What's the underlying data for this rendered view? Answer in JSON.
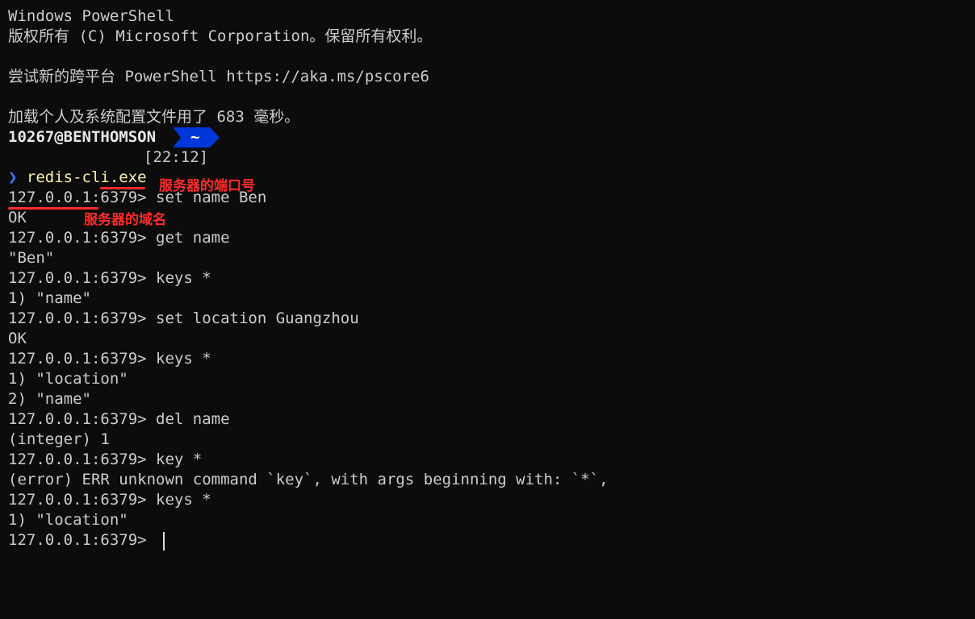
{
  "terminal": {
    "header": {
      "line1": "Windows PowerShell",
      "line2": "版权所有 (C) Microsoft Corporation。保留所有权利。",
      "line3": "尝试新的跨平台 PowerShell https://aka.ms/pscore6",
      "line4": "加载个人及系统配置文件用了 683 毫秒。"
    },
    "prompt": {
      "user_host": "10267@BENTHOMSON",
      "path": "~",
      "time": "[22:12]",
      "chevron": "❯",
      "command": "redis-cli.exe"
    },
    "annotations": {
      "port_label": "服务器的端口号",
      "host_label": "服务器的域名"
    },
    "session": [
      {
        "host": "127.0.0.1",
        "port_part": ":6379> ",
        "cmd": "set name Ben"
      },
      {
        "out": "OK"
      },
      {
        "host": "127.0.0.1",
        "port_part": ":6379> ",
        "cmd": "get name"
      },
      {
        "out": "\"Ben\""
      },
      {
        "host": "127.0.0.1",
        "port_part": ":6379> ",
        "cmd": "keys *"
      },
      {
        "out": "1) \"name\""
      },
      {
        "host": "127.0.0.1",
        "port_part": ":6379> ",
        "cmd": "set location Guangzhou"
      },
      {
        "out": "OK"
      },
      {
        "host": "127.0.0.1",
        "port_part": ":6379> ",
        "cmd": "keys *"
      },
      {
        "out": "1) \"location\""
      },
      {
        "out": "2) \"name\""
      },
      {
        "host": "127.0.0.1",
        "port_part": ":6379> ",
        "cmd": "del name"
      },
      {
        "out": "(integer) 1"
      },
      {
        "host": "127.0.0.1",
        "port_part": ":6379> ",
        "cmd": "key *"
      },
      {
        "out": "(error) ERR unknown command `key`, with args beginning with: `*`,"
      },
      {
        "host": "127.0.0.1",
        "port_part": ":6379> ",
        "cmd": "keys *"
      },
      {
        "out": "1) \"location\""
      },
      {
        "host": "127.0.0.1",
        "port_part": ":6379> ",
        "cmd": ""
      }
    ],
    "colors": {
      "background": "#0c0c0c",
      "text": "#cccccc",
      "powerline_bg": "#0037da",
      "command_yellow": "#f9f1a5",
      "annotation_red": "#ff2b2b"
    }
  }
}
